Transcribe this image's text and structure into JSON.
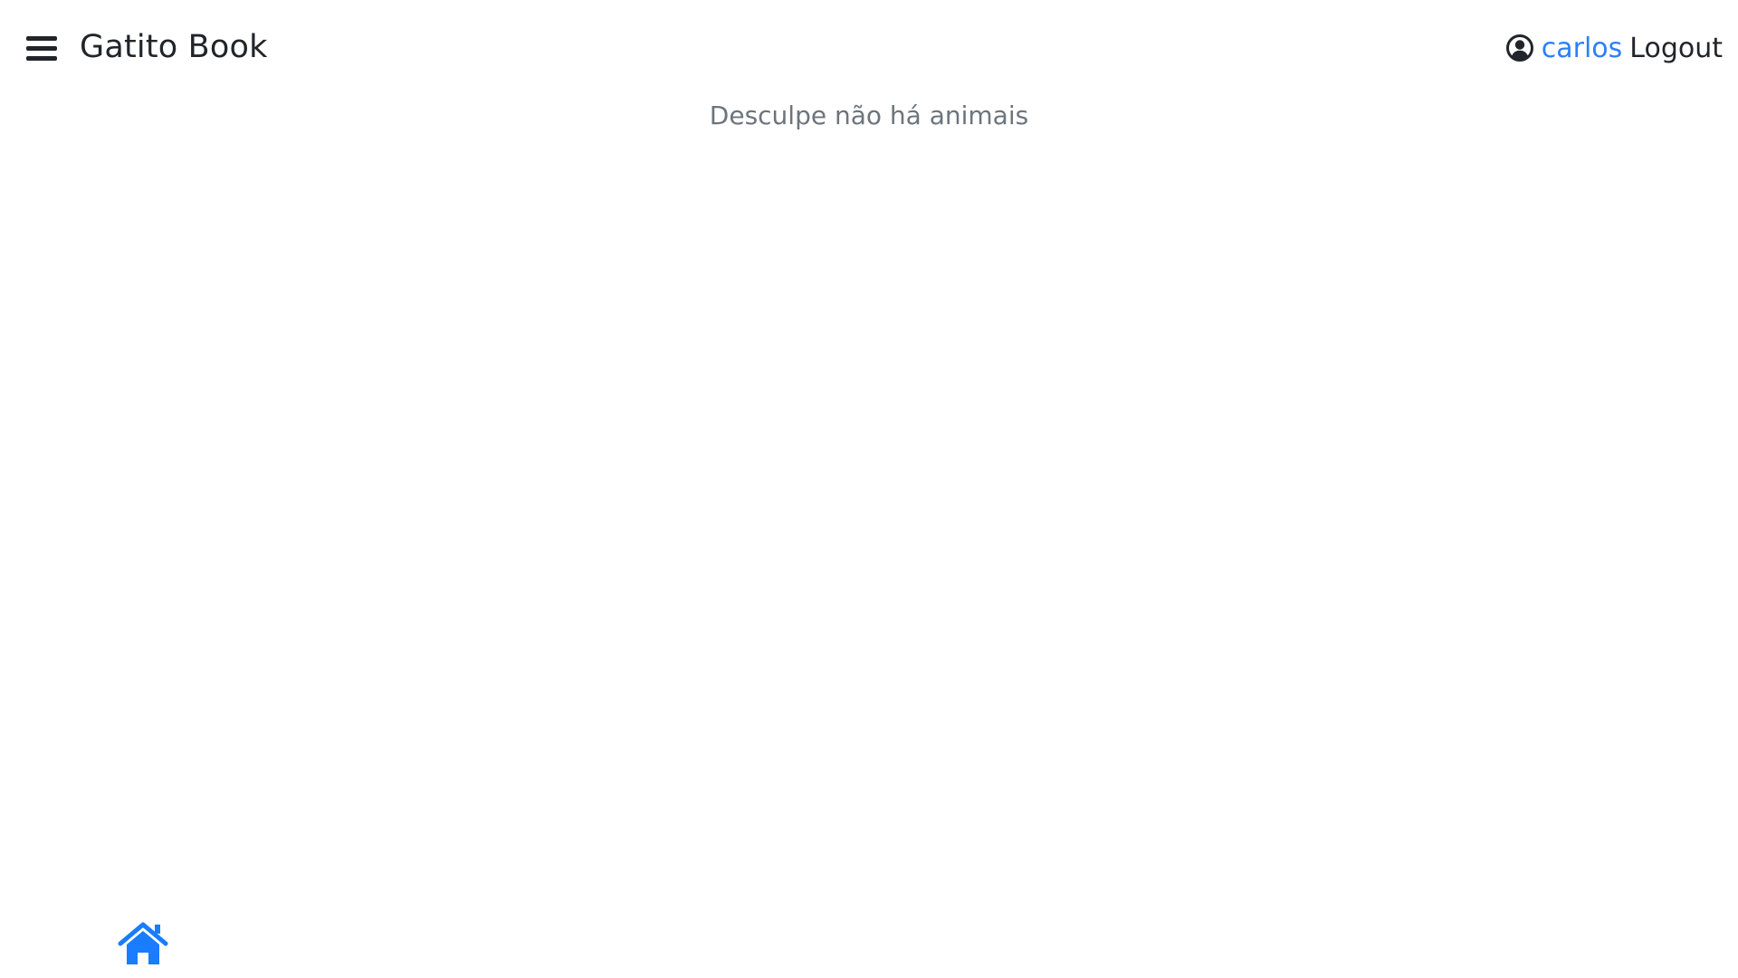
{
  "header": {
    "menu_icon": "hamburger-menu-icon",
    "title": "Gatito Book",
    "user_icon": "user-circle-icon",
    "username": "carlos",
    "logout_label": "Logout"
  },
  "main": {
    "empty_message": "Desculpe não há animais"
  },
  "footer": {
    "home_icon": "home-icon"
  },
  "colors": {
    "accent": "#2d7ff9",
    "text": "#212529",
    "muted": "#6c757d",
    "home": "#1a7cff"
  }
}
